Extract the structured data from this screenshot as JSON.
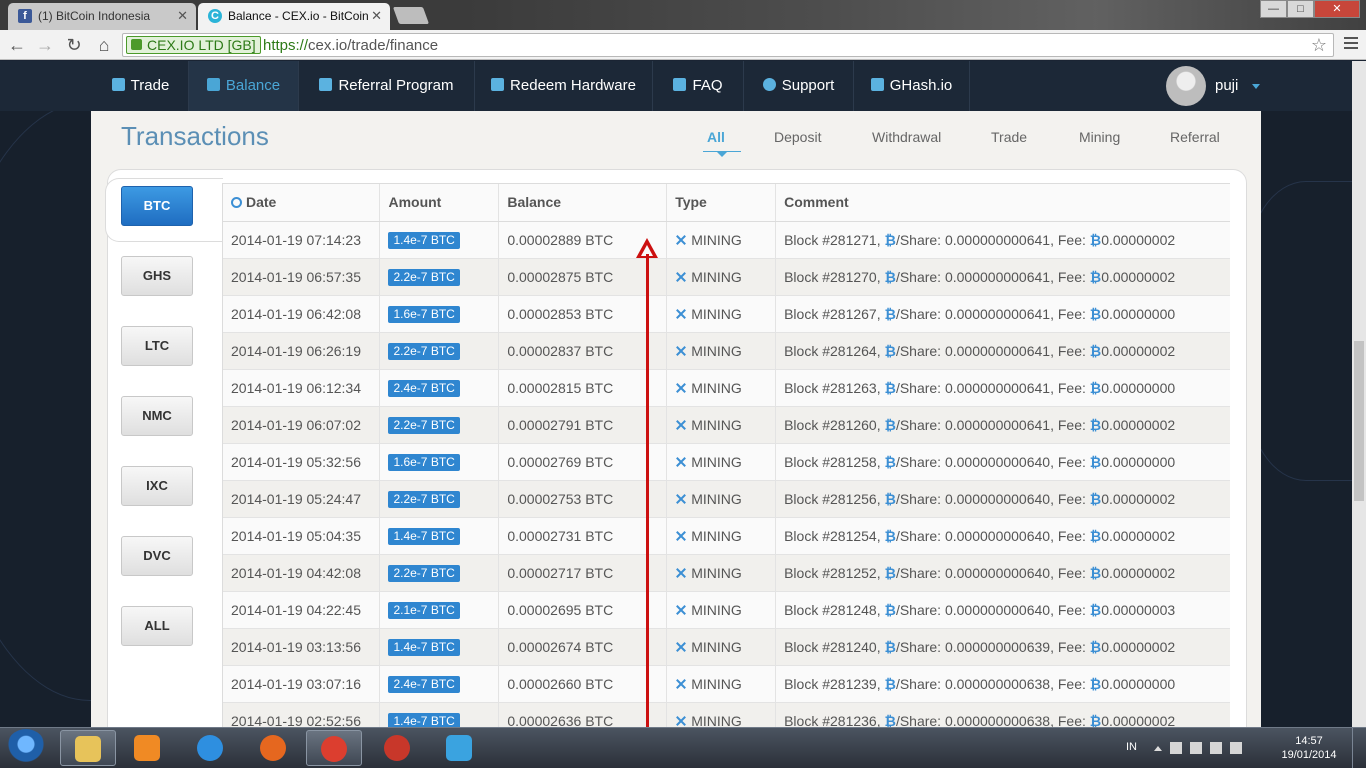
{
  "browser": {
    "tabs": [
      {
        "title": "(1) BitCoin Indonesia",
        "active": false,
        "favicon": "facebook-icon",
        "favicon_color": "#3b5998"
      },
      {
        "title": "Balance - CEX.io - BitCoin",
        "active": true,
        "favicon": "cexio-icon",
        "favicon_color": "#2bb4d8"
      }
    ],
    "window_controls": {
      "minimize": "—",
      "maximize": "□",
      "close": "✕"
    },
    "ev_cert": "CEX.IO LTD [GB]",
    "url_scheme": "https://",
    "url_rest": "cex.io/trade/finance"
  },
  "site_nav": {
    "items": [
      {
        "label": "Trade",
        "icon": "chart-icon",
        "active": false
      },
      {
        "label": "Balance",
        "icon": "wallet-icon",
        "active": true
      },
      {
        "label": "Referral Program",
        "icon": "users-icon",
        "active": false
      },
      {
        "label": "Redeem Hardware",
        "icon": "cube-icon",
        "active": false
      },
      {
        "label": "FAQ",
        "icon": "shield-icon",
        "active": false
      },
      {
        "label": "Support",
        "icon": "lifebuoy-icon",
        "active": false
      },
      {
        "label": "GHash.io",
        "icon": "pickaxe-icon",
        "active": false
      }
    ],
    "username": "puji"
  },
  "transactions": {
    "title": "Transactions",
    "filters": [
      {
        "label": "All",
        "active": true
      },
      {
        "label": "Deposit",
        "active": false
      },
      {
        "label": "Withdrawal",
        "active": false
      },
      {
        "label": "Trade",
        "active": false
      },
      {
        "label": "Mining",
        "active": false
      },
      {
        "label": "Referral",
        "active": false
      }
    ],
    "currencies": [
      {
        "label": "BTC",
        "active": true
      },
      {
        "label": "GHS",
        "active": false
      },
      {
        "label": "LTC",
        "active": false
      },
      {
        "label": "NMC",
        "active": false
      },
      {
        "label": "IXC",
        "active": false
      },
      {
        "label": "DVC",
        "active": false
      },
      {
        "label": "ALL",
        "active": false
      }
    ],
    "columns": [
      "Date",
      "Amount",
      "Balance",
      "Type",
      "Comment"
    ],
    "rows": [
      {
        "date": "2014-01-19 07:14:23",
        "amount": "1.4e-7 BTC",
        "balance": "0.00002889 BTC",
        "type": "MINING",
        "block": "Block #281271,",
        "share_label": "/Share:",
        "share": "0.000000000641,",
        "fee_label": "Fee:",
        "fee": "0.00000002"
      },
      {
        "date": "2014-01-19 06:57:35",
        "amount": "2.2e-7 BTC",
        "balance": "0.00002875 BTC",
        "type": "MINING",
        "block": "Block #281270,",
        "share_label": "/Share:",
        "share": "0.000000000641,",
        "fee_label": "Fee:",
        "fee": "0.00000002"
      },
      {
        "date": "2014-01-19 06:42:08",
        "amount": "1.6e-7 BTC",
        "balance": "0.00002853 BTC",
        "type": "MINING",
        "block": "Block #281267,",
        "share_label": "/Share:",
        "share": "0.000000000641,",
        "fee_label": "Fee:",
        "fee": "0.00000000"
      },
      {
        "date": "2014-01-19 06:26:19",
        "amount": "2.2e-7 BTC",
        "balance": "0.00002837 BTC",
        "type": "MINING",
        "block": "Block #281264,",
        "share_label": "/Share:",
        "share": "0.000000000641,",
        "fee_label": "Fee:",
        "fee": "0.00000002"
      },
      {
        "date": "2014-01-19 06:12:34",
        "amount": "2.4e-7 BTC",
        "balance": "0.00002815 BTC",
        "type": "MINING",
        "block": "Block #281263,",
        "share_label": "/Share:",
        "share": "0.000000000641,",
        "fee_label": "Fee:",
        "fee": "0.00000000"
      },
      {
        "date": "2014-01-19 06:07:02",
        "amount": "2.2e-7 BTC",
        "balance": "0.00002791 BTC",
        "type": "MINING",
        "block": "Block #281260,",
        "share_label": "/Share:",
        "share": "0.000000000641,",
        "fee_label": "Fee:",
        "fee": "0.00000002"
      },
      {
        "date": "2014-01-19 05:32:56",
        "amount": "1.6e-7 BTC",
        "balance": "0.00002769 BTC",
        "type": "MINING",
        "block": "Block #281258,",
        "share_label": "/Share:",
        "share": "0.000000000640,",
        "fee_label": "Fee:",
        "fee": "0.00000000"
      },
      {
        "date": "2014-01-19 05:24:47",
        "amount": "2.2e-7 BTC",
        "balance": "0.00002753 BTC",
        "type": "MINING",
        "block": "Block #281256,",
        "share_label": "/Share:",
        "share": "0.000000000640,",
        "fee_label": "Fee:",
        "fee": "0.00000002"
      },
      {
        "date": "2014-01-19 05:04:35",
        "amount": "1.4e-7 BTC",
        "balance": "0.00002731 BTC",
        "type": "MINING",
        "block": "Block #281254,",
        "share_label": "/Share:",
        "share": "0.000000000640,",
        "fee_label": "Fee:",
        "fee": "0.00000002"
      },
      {
        "date": "2014-01-19 04:42:08",
        "amount": "2.2e-7 BTC",
        "balance": "0.00002717 BTC",
        "type": "MINING",
        "block": "Block #281252,",
        "share_label": "/Share:",
        "share": "0.000000000640,",
        "fee_label": "Fee:",
        "fee": "0.00000002"
      },
      {
        "date": "2014-01-19 04:22:45",
        "amount": "2.1e-7 BTC",
        "balance": "0.00002695 BTC",
        "type": "MINING",
        "block": "Block #281248,",
        "share_label": "/Share:",
        "share": "0.000000000640,",
        "fee_label": "Fee:",
        "fee": "0.00000003"
      },
      {
        "date": "2014-01-19 03:13:56",
        "amount": "1.4e-7 BTC",
        "balance": "0.00002674 BTC",
        "type": "MINING",
        "block": "Block #281240,",
        "share_label": "/Share:",
        "share": "0.000000000639,",
        "fee_label": "Fee:",
        "fee": "0.00000002"
      },
      {
        "date": "2014-01-19 03:07:16",
        "amount": "2.4e-7 BTC",
        "balance": "0.00002660 BTC",
        "type": "MINING",
        "block": "Block #281239,",
        "share_label": "/Share:",
        "share": "0.000000000638,",
        "fee_label": "Fee:",
        "fee": "0.00000000"
      },
      {
        "date": "2014-01-19 02:52:56",
        "amount": "1.4e-7 BTC",
        "balance": "0.00002636 BTC",
        "type": "MINING",
        "block": "Block #281236,",
        "share_label": "/Share:",
        "share": "0.000000000638,",
        "fee_label": "Fee:",
        "fee": "0.00000002"
      }
    ]
  },
  "colors": {
    "accent": "#4aa6d6",
    "badge": "#2f86d0",
    "annotation_arrow": "#cc1010"
  },
  "taskbar": {
    "apps": [
      {
        "icon": "explorer-icon",
        "color": "#e7c35a",
        "running": true
      },
      {
        "icon": "media-player-icon",
        "color": "#f08a24",
        "running": false
      },
      {
        "icon": "internet-explorer-icon",
        "color": "#2e8fe0",
        "running": false
      },
      {
        "icon": "firefox-icon",
        "color": "#e5671f",
        "running": false
      },
      {
        "icon": "chrome-icon",
        "color": "#dc3e2f",
        "running": true
      },
      {
        "icon": "app-red-icon",
        "color": "#c8372a",
        "running": false
      },
      {
        "icon": "stock-chart-icon",
        "color": "#3aa3e0",
        "running": false
      }
    ],
    "language": "IN",
    "time": "14:57",
    "date": "19/01/2014"
  }
}
